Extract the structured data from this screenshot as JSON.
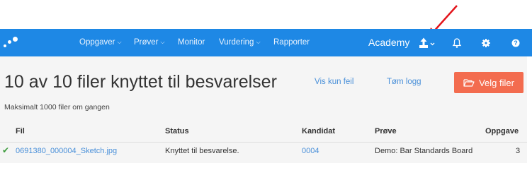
{
  "nav": {
    "items": [
      {
        "label": "Oppgaver",
        "dropdown": true
      },
      {
        "label": "Prøver",
        "dropdown": true
      },
      {
        "label": "Monitor",
        "dropdown": false
      },
      {
        "label": "Vurdering",
        "dropdown": true
      },
      {
        "label": "Rapporter",
        "dropdown": false
      }
    ],
    "brand": "Academy",
    "icons": [
      "upload-icon",
      "bell-icon",
      "gear-icon",
      "help-icon"
    ],
    "bar_color": "#1e88e5"
  },
  "page": {
    "title": "10 av 10 filer knyttet til besvarelser",
    "show_errors_only": "Vis kun feil",
    "clear_log": "Tøm logg",
    "select_files": "Velg filer",
    "hint": "Maksimalt 1000 filer om gangen",
    "accent_color": "#f36c4f"
  },
  "table": {
    "headers": [
      "Fil",
      "Status",
      "Kandidat",
      "Prøve",
      "Oppgave"
    ],
    "rows": [
      {
        "status_icon": "check-icon",
        "file": "0691380_000004_Sketch.jpg",
        "status": "Knyttet til besvarelse.",
        "candidate": "0004",
        "test": "Demo: Bar Standards Board",
        "task": "3"
      }
    ]
  },
  "annotation": {
    "arrow_color": "#e3141b"
  }
}
